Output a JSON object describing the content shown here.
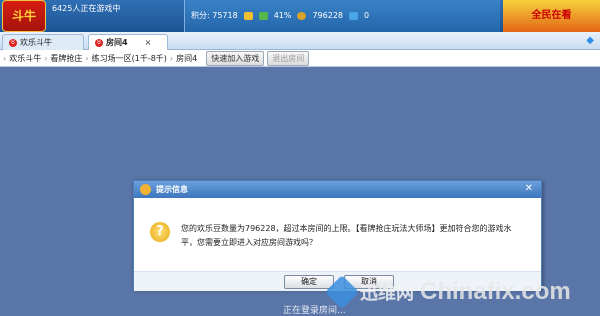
{
  "header": {
    "logo_text": "斗牛",
    "online_text": "6425人正在游戏中",
    "score_label": "积分: 75718",
    "win_rate": "41%",
    "beans": "796228",
    "gems": "0",
    "ad_text": "全民在看"
  },
  "tabs": [
    {
      "label": "欢乐斗牛"
    },
    {
      "label": "房间4"
    }
  ],
  "breadcrumb": {
    "items": [
      "欢乐斗牛",
      "看牌抢庄",
      "练习场一区(1千-8千)",
      "房间4"
    ],
    "quick_join": "快速加入游戏",
    "leave": "退出房间"
  },
  "dialog": {
    "title": "提示信息",
    "message": "您的欢乐豆数量为796228，超过本房间的上限。【看牌抢庄玩法大师场】更加符合您的游戏水平，您需要立即进入对应房间游戏吗？",
    "ok": "确定",
    "cancel": "取消"
  },
  "status_text": "正在登录房间...",
  "watermark": {
    "cn": "迅维网",
    "en": "Chinafix.com"
  },
  "colors": {
    "accent": "#2f6fb5",
    "background": "#5a76a8"
  }
}
